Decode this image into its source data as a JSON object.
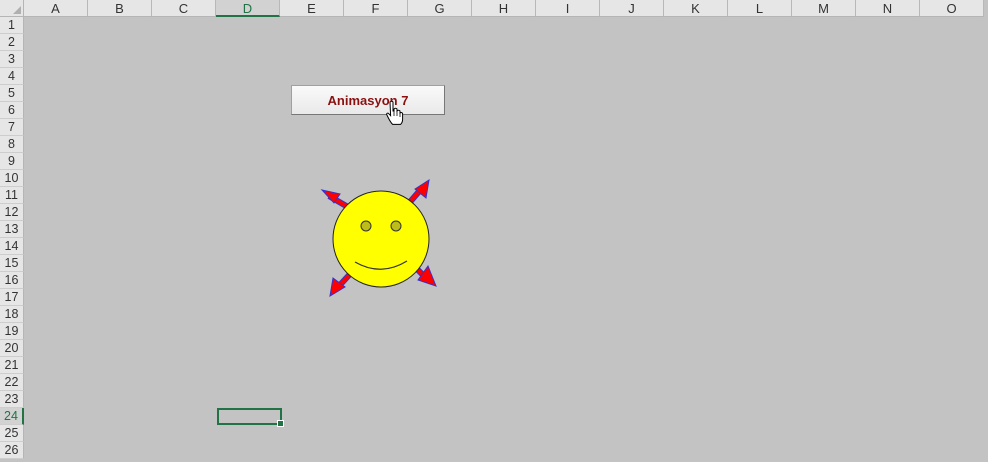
{
  "columns": [
    "A",
    "B",
    "C",
    "D",
    "E",
    "F",
    "G",
    "H",
    "I",
    "J",
    "K",
    "L",
    "M",
    "N",
    "O"
  ],
  "rows": [
    "1",
    "2",
    "3",
    "4",
    "5",
    "6",
    "7",
    "8",
    "9",
    "10",
    "11",
    "12",
    "13",
    "14",
    "15",
    "16",
    "17",
    "18",
    "19",
    "20",
    "21",
    "22",
    "23",
    "24",
    "25",
    "26"
  ],
  "active_column": "D",
  "active_row": "24",
  "button": {
    "label": "Animasyon 7"
  },
  "colors": {
    "smiley_face": "#ffff00",
    "arrow_fill": "#ff0000",
    "arrow_outline": "#3333cc",
    "button_text": "#8b1010",
    "selection": "#217346"
  }
}
